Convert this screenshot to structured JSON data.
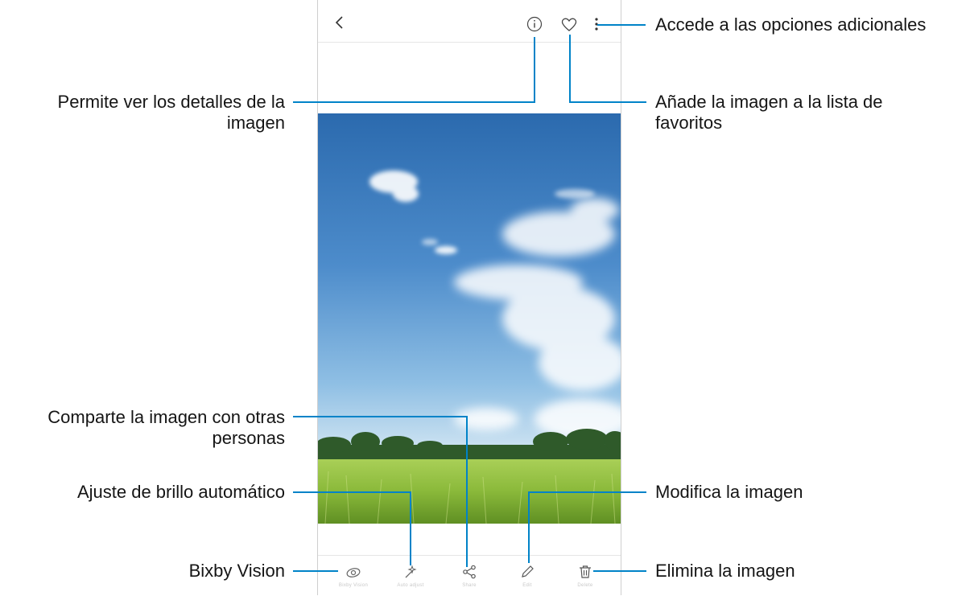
{
  "toolbar": {
    "back": "back-icon",
    "info": "info-icon",
    "favorite": "heart-icon",
    "more": "more-options-icon"
  },
  "bottom_bar": {
    "items": [
      {
        "icon": "bixby-vision-icon",
        "label": "Bixby Vision"
      },
      {
        "icon": "auto-adjust-icon",
        "label": "Auto adjust"
      },
      {
        "icon": "share-icon",
        "label": "Share"
      },
      {
        "icon": "edit-icon",
        "label": "Edit"
      },
      {
        "icon": "delete-icon",
        "label": "Delete"
      }
    ]
  },
  "callouts": {
    "more_options": "Accede a las opciones adicionales",
    "details_line1": "Permite ver los detalles de la",
    "details_line2": "imagen",
    "favorites_line1": "Añade la imagen a la lista de",
    "favorites_line2": "favoritos",
    "share_line1": "Comparte la imagen con otras",
    "share_line2": "personas",
    "brightness": "Ajuste de brillo automático",
    "edit": "Modifica la imagen",
    "bixby": "Bixby Vision",
    "delete": "Elimina la imagen"
  },
  "colors": {
    "leader_line": "#0083c8",
    "sky_top": "#2a6fb3",
    "sky_bottom": "#8cbde3",
    "grass": "#8fbf3a"
  }
}
